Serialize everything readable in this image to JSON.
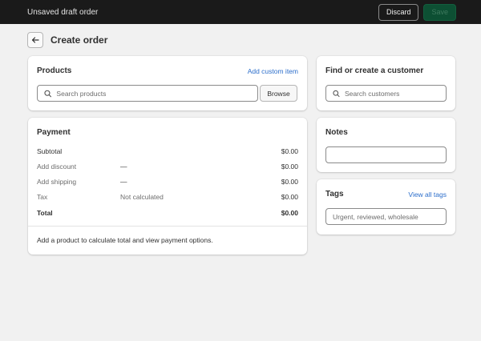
{
  "topbar": {
    "title": "Unsaved draft order",
    "discard_label": "Discard",
    "save_label": "Save"
  },
  "page": {
    "title": "Create order",
    "back_icon": "arrow-left-icon"
  },
  "products": {
    "title": "Products",
    "add_custom_label": "Add custom item",
    "search_placeholder": "Search products",
    "browse_label": "Browse"
  },
  "payment": {
    "title": "Payment",
    "rows": [
      {
        "label": "Subtotal",
        "desc": "",
        "value": "$0.00"
      },
      {
        "label": "Add discount",
        "desc": "—",
        "value": "$0.00"
      },
      {
        "label": "Add shipping",
        "desc": "—",
        "value": "$0.00"
      },
      {
        "label": "Tax",
        "desc": "Not calculated",
        "value": "$0.00"
      },
      {
        "label": "Total",
        "desc": "",
        "value": "$0.00"
      }
    ],
    "note": "Add a product to calculate total and view payment options."
  },
  "customer": {
    "title": "Find or create a customer",
    "search_placeholder": "Search customers"
  },
  "notes": {
    "title": "Notes",
    "value": ""
  },
  "tags": {
    "title": "Tags",
    "view_all_label": "View all tags",
    "placeholder": "Urgent, reviewed, wholesale"
  },
  "colors": {
    "topbar_bg": "#1a1a1a",
    "page_bg": "#f1f1f1",
    "link": "#2c6ecb",
    "save_disabled_bg": "#0d4f33"
  }
}
